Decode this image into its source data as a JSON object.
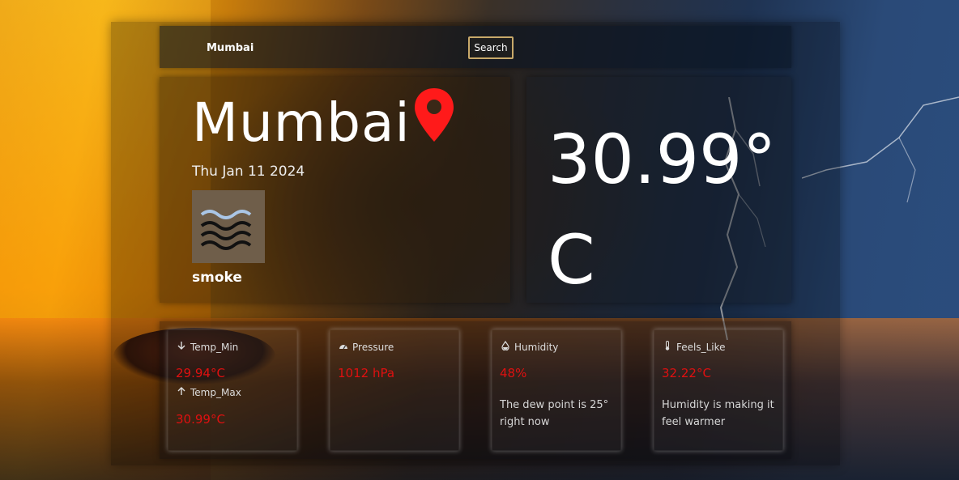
{
  "search": {
    "value": "Mumbai",
    "button_label": "Search"
  },
  "city_card": {
    "city": "Mumbai",
    "date": "Thu Jan 11 2024",
    "condition": "smoke",
    "weather_icon": "haze-icon",
    "pin_icon": "map-pin-icon"
  },
  "temp_card": {
    "temperature": "30.99° C"
  },
  "details": {
    "temp": {
      "min_label": "Temp_Min",
      "min_value": "29.94°C",
      "max_label": "Temp_Max",
      "max_value": "30.99°C"
    },
    "pressure": {
      "label": "Pressure",
      "value": "1012 hPa"
    },
    "humidity": {
      "label": "Humidity",
      "value": "48%",
      "note": "The dew point is 25° right now"
    },
    "feels_like": {
      "label": "Feels_Like",
      "value": "32.22°C",
      "note": "Humidity is making it feel warmer"
    }
  },
  "colors": {
    "accent_red": "#e01010",
    "pin_red": "#ff1a1a"
  }
}
